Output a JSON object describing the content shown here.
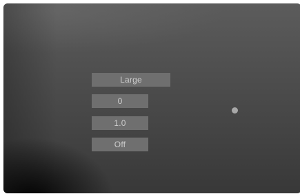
{
  "settings": {
    "size_value": "Large",
    "offset_value": "0",
    "scale_value": "1.0",
    "toggle_value": "Off"
  },
  "indicator": {
    "icon": "dot-icon",
    "color": "#a8a8a8"
  }
}
